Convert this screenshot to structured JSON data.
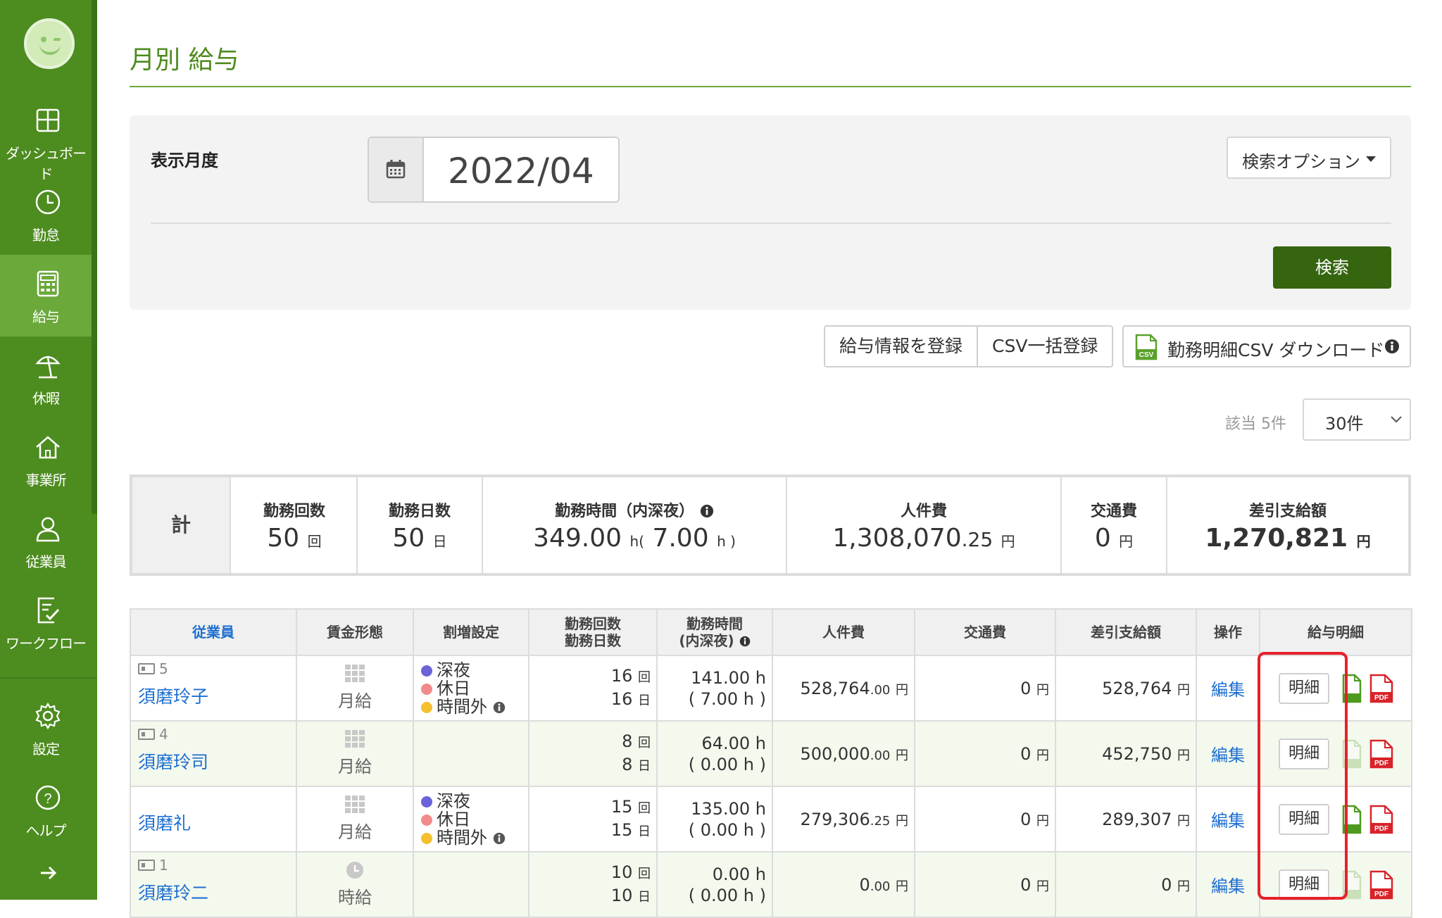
{
  "sidebar": {
    "items": [
      {
        "label": "ダッシュボード",
        "icon": "dashboard-icon"
      },
      {
        "label": "勤怠",
        "icon": "clock-icon"
      },
      {
        "label": "給与",
        "icon": "calculator-icon"
      },
      {
        "label": "休暇",
        "icon": "beach-umbrella-icon"
      },
      {
        "label": "事業所",
        "icon": "home-icon"
      },
      {
        "label": "従業員",
        "icon": "person-icon"
      },
      {
        "label": "ワークフロー",
        "icon": "workflow-icon"
      },
      {
        "label": "設定",
        "icon": "gear-icon"
      },
      {
        "label": "ヘルプ",
        "icon": "help-icon"
      }
    ],
    "active_index": 2,
    "colors": {
      "bg": "#4d8c1f",
      "active": "#6aa93a"
    }
  },
  "page": {
    "title": "月別 給与"
  },
  "search": {
    "label": "表示月度",
    "month_value": "2022/04",
    "options_label": "検索オプション",
    "search_button": "検索"
  },
  "actions": {
    "register": "給与情報を登録",
    "csv_bulk": "CSV一括登録",
    "csv_download": "勤務明細CSV ダウンロード"
  },
  "paging": {
    "count_label": "該当 5件",
    "per_page": "30件"
  },
  "totals": {
    "label": "計",
    "shifts": {
      "header": "勤務回数",
      "value": "50",
      "unit": "回"
    },
    "days": {
      "header": "勤務日数",
      "value": "50",
      "unit": "日"
    },
    "hours": {
      "header": "勤務時間（内深夜）",
      "value": "349.00",
      "unit": "h",
      "open": "(",
      "night": "7.00",
      "close": "h )"
    },
    "labor": {
      "header": "人件費",
      "value": "1,308,070",
      "decimal": ".25",
      "unit": "円"
    },
    "transport": {
      "header": "交通費",
      "value": "0",
      "unit": "円"
    },
    "net": {
      "header": "差引支給額",
      "value": "1,270,821",
      "unit": "円"
    }
  },
  "table": {
    "headers": {
      "employee": "従業員",
      "wage_type": "賃金形態",
      "premium": "割増設定",
      "count_1": "勤務回数",
      "count_2": "勤務日数",
      "hours_1": "勤務時間",
      "hours_2": "(内深夜)",
      "labor": "人件費",
      "transport": "交通費",
      "net": "差引支給額",
      "ops": "操作",
      "payslip": "給与明細"
    },
    "premium_labels": {
      "night": "深夜",
      "holiday": "休日",
      "overtime": "時間外"
    },
    "premium_colors": {
      "night": "#6b63d8",
      "holiday": "#f28a8a",
      "overtime": "#f5c02e"
    },
    "units": {
      "shifts": "回",
      "days": "日",
      "hours": "h",
      "yen": "円"
    },
    "edit_label": "編集",
    "payslip_label": "明細",
    "rows": [
      {
        "id": "5",
        "name": "須磨玲子",
        "wage": "月給",
        "shifts": "16",
        "days": "16",
        "hours": "141.00",
        "night": "( 7.00 h )",
        "labor": "528,764",
        "labor_dec": ".00",
        "transport": "0",
        "net": "528,764"
      },
      {
        "id": "4",
        "name": "須磨玲司",
        "wage": "月給",
        "shifts": "8",
        "days": "8",
        "hours": "64.00",
        "night": "( 0.00 h )",
        "labor": "500,000",
        "labor_dec": ".00",
        "transport": "0",
        "net": "452,750"
      },
      {
        "id": "",
        "name": "須磨礼",
        "wage": "月給",
        "shifts": "15",
        "days": "15",
        "hours": "135.00",
        "night": "( 0.00 h )",
        "labor": "279,306",
        "labor_dec": ".25",
        "transport": "0",
        "net": "289,307"
      },
      {
        "id": "1",
        "name": "須磨玲二",
        "wage": "時給",
        "shifts": "10",
        "days": "10",
        "hours": "0.00",
        "night": "( 0.00 h )",
        "labor": "0",
        "labor_dec": ".00",
        "transport": "0",
        "net": "0"
      }
    ]
  }
}
